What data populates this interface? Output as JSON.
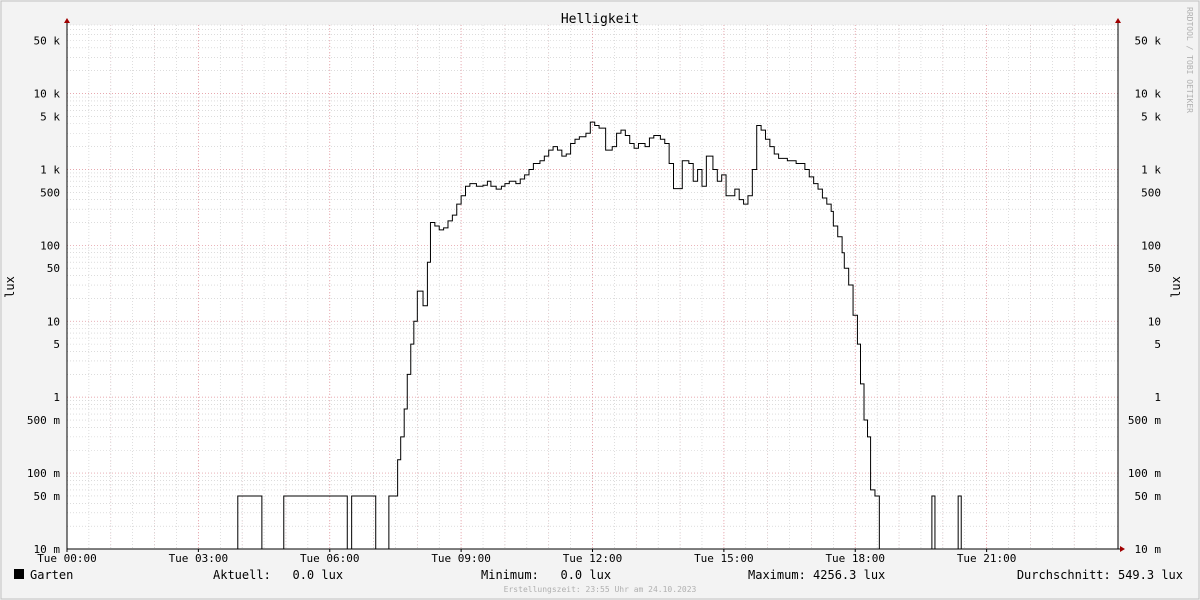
{
  "chart_data": {
    "type": "line",
    "title": "Helligkeit",
    "ylabel": "lux",
    "ylabel_right": "lux",
    "y_scale": "log",
    "ylim": [
      0.01,
      80000
    ],
    "xlim": [
      0,
      24
    ],
    "watermark": "RRDTOOL / TOBI OETIKER",
    "y_ticks": [
      {
        "v": 50000,
        "label": "50 k"
      },
      {
        "v": 10000,
        "label": "10 k"
      },
      {
        "v": 5000,
        "label": "5 k"
      },
      {
        "v": 1000,
        "label": "1 k"
      },
      {
        "v": 500,
        "label": "500"
      },
      {
        "v": 100,
        "label": "100"
      },
      {
        "v": 50,
        "label": "50"
      },
      {
        "v": 10,
        "label": "10"
      },
      {
        "v": 5,
        "label": "5"
      },
      {
        "v": 1,
        "label": "1"
      },
      {
        "v": 0.5,
        "label": "500 m"
      },
      {
        "v": 0.1,
        "label": "100 m"
      },
      {
        "v": 0.05,
        "label": "50 m"
      },
      {
        "v": 0.01,
        "label": "10 m"
      }
    ],
    "x_ticks": [
      {
        "v": 0,
        "label": "Tue 00:00"
      },
      {
        "v": 3,
        "label": "Tue 03:00"
      },
      {
        "v": 6,
        "label": "Tue 06:00"
      },
      {
        "v": 9,
        "label": "Tue 09:00"
      },
      {
        "v": 12,
        "label": "Tue 12:00"
      },
      {
        "v": 15,
        "label": "Tue 15:00"
      },
      {
        "v": 18,
        "label": "Tue 18:00"
      },
      {
        "v": 21,
        "label": "Tue 21:00"
      }
    ],
    "series": [
      {
        "name": "Garten",
        "color": "#000000",
        "points": [
          [
            0.0,
            0.01
          ],
          [
            3.9,
            0.01
          ],
          [
            3.9,
            0.05
          ],
          [
            4.45,
            0.05
          ],
          [
            4.45,
            0.01
          ],
          [
            4.95,
            0.01
          ],
          [
            4.95,
            0.05
          ],
          [
            6.4,
            0.05
          ],
          [
            6.4,
            0.01
          ],
          [
            6.5,
            0.01
          ],
          [
            6.5,
            0.05
          ],
          [
            7.05,
            0.05
          ],
          [
            7.05,
            0.01
          ],
          [
            7.35,
            0.01
          ],
          [
            7.35,
            0.05
          ],
          [
            7.55,
            0.05
          ],
          [
            7.55,
            0.15
          ],
          [
            7.62,
            0.15
          ],
          [
            7.62,
            0.3
          ],
          [
            7.7,
            0.3
          ],
          [
            7.7,
            0.7
          ],
          [
            7.77,
            0.7
          ],
          [
            7.77,
            2
          ],
          [
            7.85,
            2
          ],
          [
            7.85,
            5
          ],
          [
            7.92,
            5
          ],
          [
            7.92,
            10
          ],
          [
            8.0,
            10
          ],
          [
            8.0,
            25
          ],
          [
            8.13,
            25
          ],
          [
            8.13,
            16
          ],
          [
            8.23,
            16
          ],
          [
            8.23,
            60
          ],
          [
            8.3,
            60
          ],
          [
            8.3,
            200
          ],
          [
            8.4,
            200
          ],
          [
            8.4,
            180
          ],
          [
            8.5,
            180
          ],
          [
            8.5,
            160
          ],
          [
            8.6,
            160
          ],
          [
            8.6,
            170
          ],
          [
            8.7,
            170
          ],
          [
            8.7,
            210
          ],
          [
            8.8,
            210
          ],
          [
            8.8,
            250
          ],
          [
            8.9,
            250
          ],
          [
            8.9,
            350
          ],
          [
            9.0,
            350
          ],
          [
            9.0,
            450
          ],
          [
            9.1,
            450
          ],
          [
            9.1,
            600
          ],
          [
            9.2,
            600
          ],
          [
            9.2,
            650
          ],
          [
            9.35,
            650
          ],
          [
            9.35,
            600
          ],
          [
            9.5,
            600
          ],
          [
            9.5,
            620
          ],
          [
            9.6,
            620
          ],
          [
            9.6,
            700
          ],
          [
            9.68,
            700
          ],
          [
            9.68,
            600
          ],
          [
            9.8,
            600
          ],
          [
            9.8,
            550
          ],
          [
            9.92,
            550
          ],
          [
            9.92,
            600
          ],
          [
            10.0,
            600
          ],
          [
            10.0,
            650
          ],
          [
            10.1,
            650
          ],
          [
            10.1,
            700
          ],
          [
            10.25,
            700
          ],
          [
            10.25,
            650
          ],
          [
            10.35,
            650
          ],
          [
            10.35,
            750
          ],
          [
            10.45,
            750
          ],
          [
            10.45,
            850
          ],
          [
            10.55,
            850
          ],
          [
            10.55,
            1000
          ],
          [
            10.65,
            1000
          ],
          [
            10.65,
            1200
          ],
          [
            10.8,
            1200
          ],
          [
            10.8,
            1300
          ],
          [
            10.9,
            1300
          ],
          [
            10.9,
            1500
          ],
          [
            11.0,
            1500
          ],
          [
            11.0,
            1800
          ],
          [
            11.1,
            1800
          ],
          [
            11.1,
            2000
          ],
          [
            11.2,
            2000
          ],
          [
            11.2,
            1800
          ],
          [
            11.3,
            1800
          ],
          [
            11.3,
            1500
          ],
          [
            11.4,
            1500
          ],
          [
            11.4,
            1600
          ],
          [
            11.5,
            1600
          ],
          [
            11.5,
            2200
          ],
          [
            11.6,
            2200
          ],
          [
            11.6,
            2500
          ],
          [
            11.7,
            2500
          ],
          [
            11.7,
            2700
          ],
          [
            11.85,
            2700
          ],
          [
            11.85,
            3000
          ],
          [
            11.95,
            3000
          ],
          [
            11.95,
            4200
          ],
          [
            12.05,
            4200
          ],
          [
            12.05,
            3800
          ],
          [
            12.15,
            3800
          ],
          [
            12.15,
            3500
          ],
          [
            12.3,
            3500
          ],
          [
            12.3,
            1800
          ],
          [
            12.45,
            1800
          ],
          [
            12.45,
            2000
          ],
          [
            12.55,
            2000
          ],
          [
            12.55,
            3000
          ],
          [
            12.65,
            3000
          ],
          [
            12.65,
            3300
          ],
          [
            12.75,
            3300
          ],
          [
            12.75,
            2800
          ],
          [
            12.85,
            2800
          ],
          [
            12.85,
            2200
          ],
          [
            12.95,
            2200
          ],
          [
            12.95,
            1900
          ],
          [
            13.05,
            1900
          ],
          [
            13.05,
            2200
          ],
          [
            13.2,
            2200
          ],
          [
            13.2,
            2000
          ],
          [
            13.3,
            2000
          ],
          [
            13.3,
            2600
          ],
          [
            13.4,
            2600
          ],
          [
            13.4,
            2800
          ],
          [
            13.55,
            2800
          ],
          [
            13.55,
            2500
          ],
          [
            13.65,
            2500
          ],
          [
            13.65,
            2200
          ],
          [
            13.75,
            2200
          ],
          [
            13.75,
            1200
          ],
          [
            13.85,
            1200
          ],
          [
            13.85,
            560
          ],
          [
            14.05,
            560
          ],
          [
            14.05,
            1300
          ],
          [
            14.2,
            1300
          ],
          [
            14.2,
            1200
          ],
          [
            14.3,
            1200
          ],
          [
            14.3,
            700
          ],
          [
            14.4,
            700
          ],
          [
            14.4,
            1000
          ],
          [
            14.5,
            1000
          ],
          [
            14.5,
            600
          ],
          [
            14.6,
            600
          ],
          [
            14.6,
            1500
          ],
          [
            14.75,
            1500
          ],
          [
            14.75,
            1000
          ],
          [
            14.85,
            1000
          ],
          [
            14.85,
            700
          ],
          [
            14.95,
            700
          ],
          [
            14.95,
            850
          ],
          [
            15.05,
            850
          ],
          [
            15.05,
            450
          ],
          [
            15.25,
            450
          ],
          [
            15.25,
            550
          ],
          [
            15.35,
            550
          ],
          [
            15.35,
            400
          ],
          [
            15.45,
            400
          ],
          [
            15.45,
            350
          ],
          [
            15.55,
            350
          ],
          [
            15.55,
            450
          ],
          [
            15.65,
            450
          ],
          [
            15.65,
            1000
          ],
          [
            15.75,
            1000
          ],
          [
            15.75,
            3800
          ],
          [
            15.85,
            3800
          ],
          [
            15.85,
            3300
          ],
          [
            15.95,
            3300
          ],
          [
            15.95,
            2500
          ],
          [
            16.05,
            2500
          ],
          [
            16.05,
            2000
          ],
          [
            16.15,
            2000
          ],
          [
            16.15,
            1600
          ],
          [
            16.25,
            1600
          ],
          [
            16.25,
            1400
          ],
          [
            16.45,
            1400
          ],
          [
            16.45,
            1300
          ],
          [
            16.65,
            1300
          ],
          [
            16.65,
            1200
          ],
          [
            16.85,
            1200
          ],
          [
            16.85,
            1000
          ],
          [
            16.95,
            1000
          ],
          [
            16.95,
            800
          ],
          [
            17.05,
            800
          ],
          [
            17.05,
            650
          ],
          [
            17.15,
            650
          ],
          [
            17.15,
            550
          ],
          [
            17.25,
            550
          ],
          [
            17.25,
            420
          ],
          [
            17.35,
            420
          ],
          [
            17.35,
            350
          ],
          [
            17.45,
            350
          ],
          [
            17.45,
            280
          ],
          [
            17.5,
            280
          ],
          [
            17.5,
            180
          ],
          [
            17.6,
            180
          ],
          [
            17.6,
            130
          ],
          [
            17.7,
            130
          ],
          [
            17.7,
            80
          ],
          [
            17.75,
            80
          ],
          [
            17.75,
            50
          ],
          [
            17.85,
            50
          ],
          [
            17.85,
            30
          ],
          [
            17.95,
            30
          ],
          [
            17.95,
            12
          ],
          [
            18.05,
            12
          ],
          [
            18.05,
            5
          ],
          [
            18.12,
            5
          ],
          [
            18.12,
            1.5
          ],
          [
            18.2,
            1.5
          ],
          [
            18.2,
            0.5
          ],
          [
            18.28,
            0.5
          ],
          [
            18.28,
            0.3
          ],
          [
            18.35,
            0.3
          ],
          [
            18.35,
            0.06
          ],
          [
            18.45,
            0.06
          ],
          [
            18.45,
            0.05
          ],
          [
            18.55,
            0.05
          ],
          [
            18.55,
            0.01
          ],
          [
            19.75,
            0.01
          ],
          [
            19.75,
            0.05
          ],
          [
            19.82,
            0.05
          ],
          [
            19.82,
            0.01
          ],
          [
            20.35,
            0.01
          ],
          [
            20.35,
            0.05
          ],
          [
            20.42,
            0.05
          ],
          [
            20.42,
            0.01
          ],
          [
            24.0,
            0.01
          ]
        ]
      }
    ]
  },
  "legend": {
    "series_name": "Garten",
    "swatch_color": "#000000",
    "aktuell": "Aktuell:   0.0 lux",
    "minimum": "Minimum:   0.0 lux",
    "maximum": "Maximum: 4256.3 lux",
    "durchschnitt": "Durchschnitt: 549.3 lux"
  },
  "footer": {
    "timestamp": "Erstellungszeit: 23:55 Uhr am 24.10.2023"
  },
  "colors": {
    "background": "#f3f3f3",
    "plot_background": "#ffffff",
    "major_grid": "#e8a0a8",
    "minor_grid": "#c8c8c8",
    "axis": "#000000",
    "arrow": "#a00000"
  }
}
